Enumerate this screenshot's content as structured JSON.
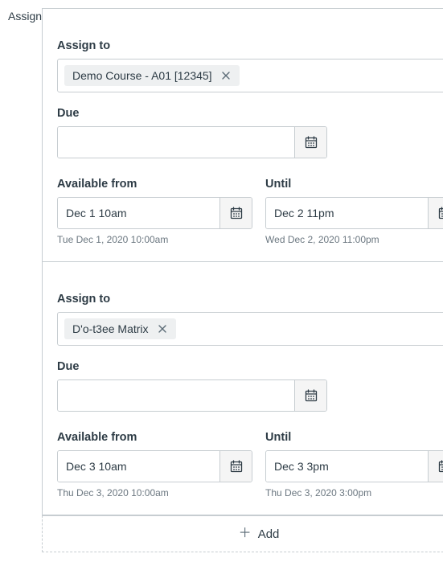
{
  "side_label": "Assign",
  "add_label": "Add",
  "labels": {
    "assign_to": "Assign to",
    "due": "Due",
    "available_from": "Available from",
    "until": "Until"
  },
  "cards": [
    {
      "assign_token": "Demo Course - A01 [12345]",
      "due_value": "",
      "due_hint": "",
      "avail_value": "Dec 1 10am",
      "avail_hint": "Tue Dec 1, 2020 10:00am",
      "until_value": "Dec 2 11pm",
      "until_hint": "Wed Dec 2, 2020 11:00pm"
    },
    {
      "assign_token": "D'o-t3ee Matrix",
      "due_value": "",
      "due_hint": "",
      "avail_value": "Dec 3 10am",
      "avail_hint": "Thu Dec 3, 2020 10:00am",
      "until_value": "Dec 3 3pm",
      "until_hint": "Thu Dec 3, 2020 3:00pm"
    }
  ]
}
